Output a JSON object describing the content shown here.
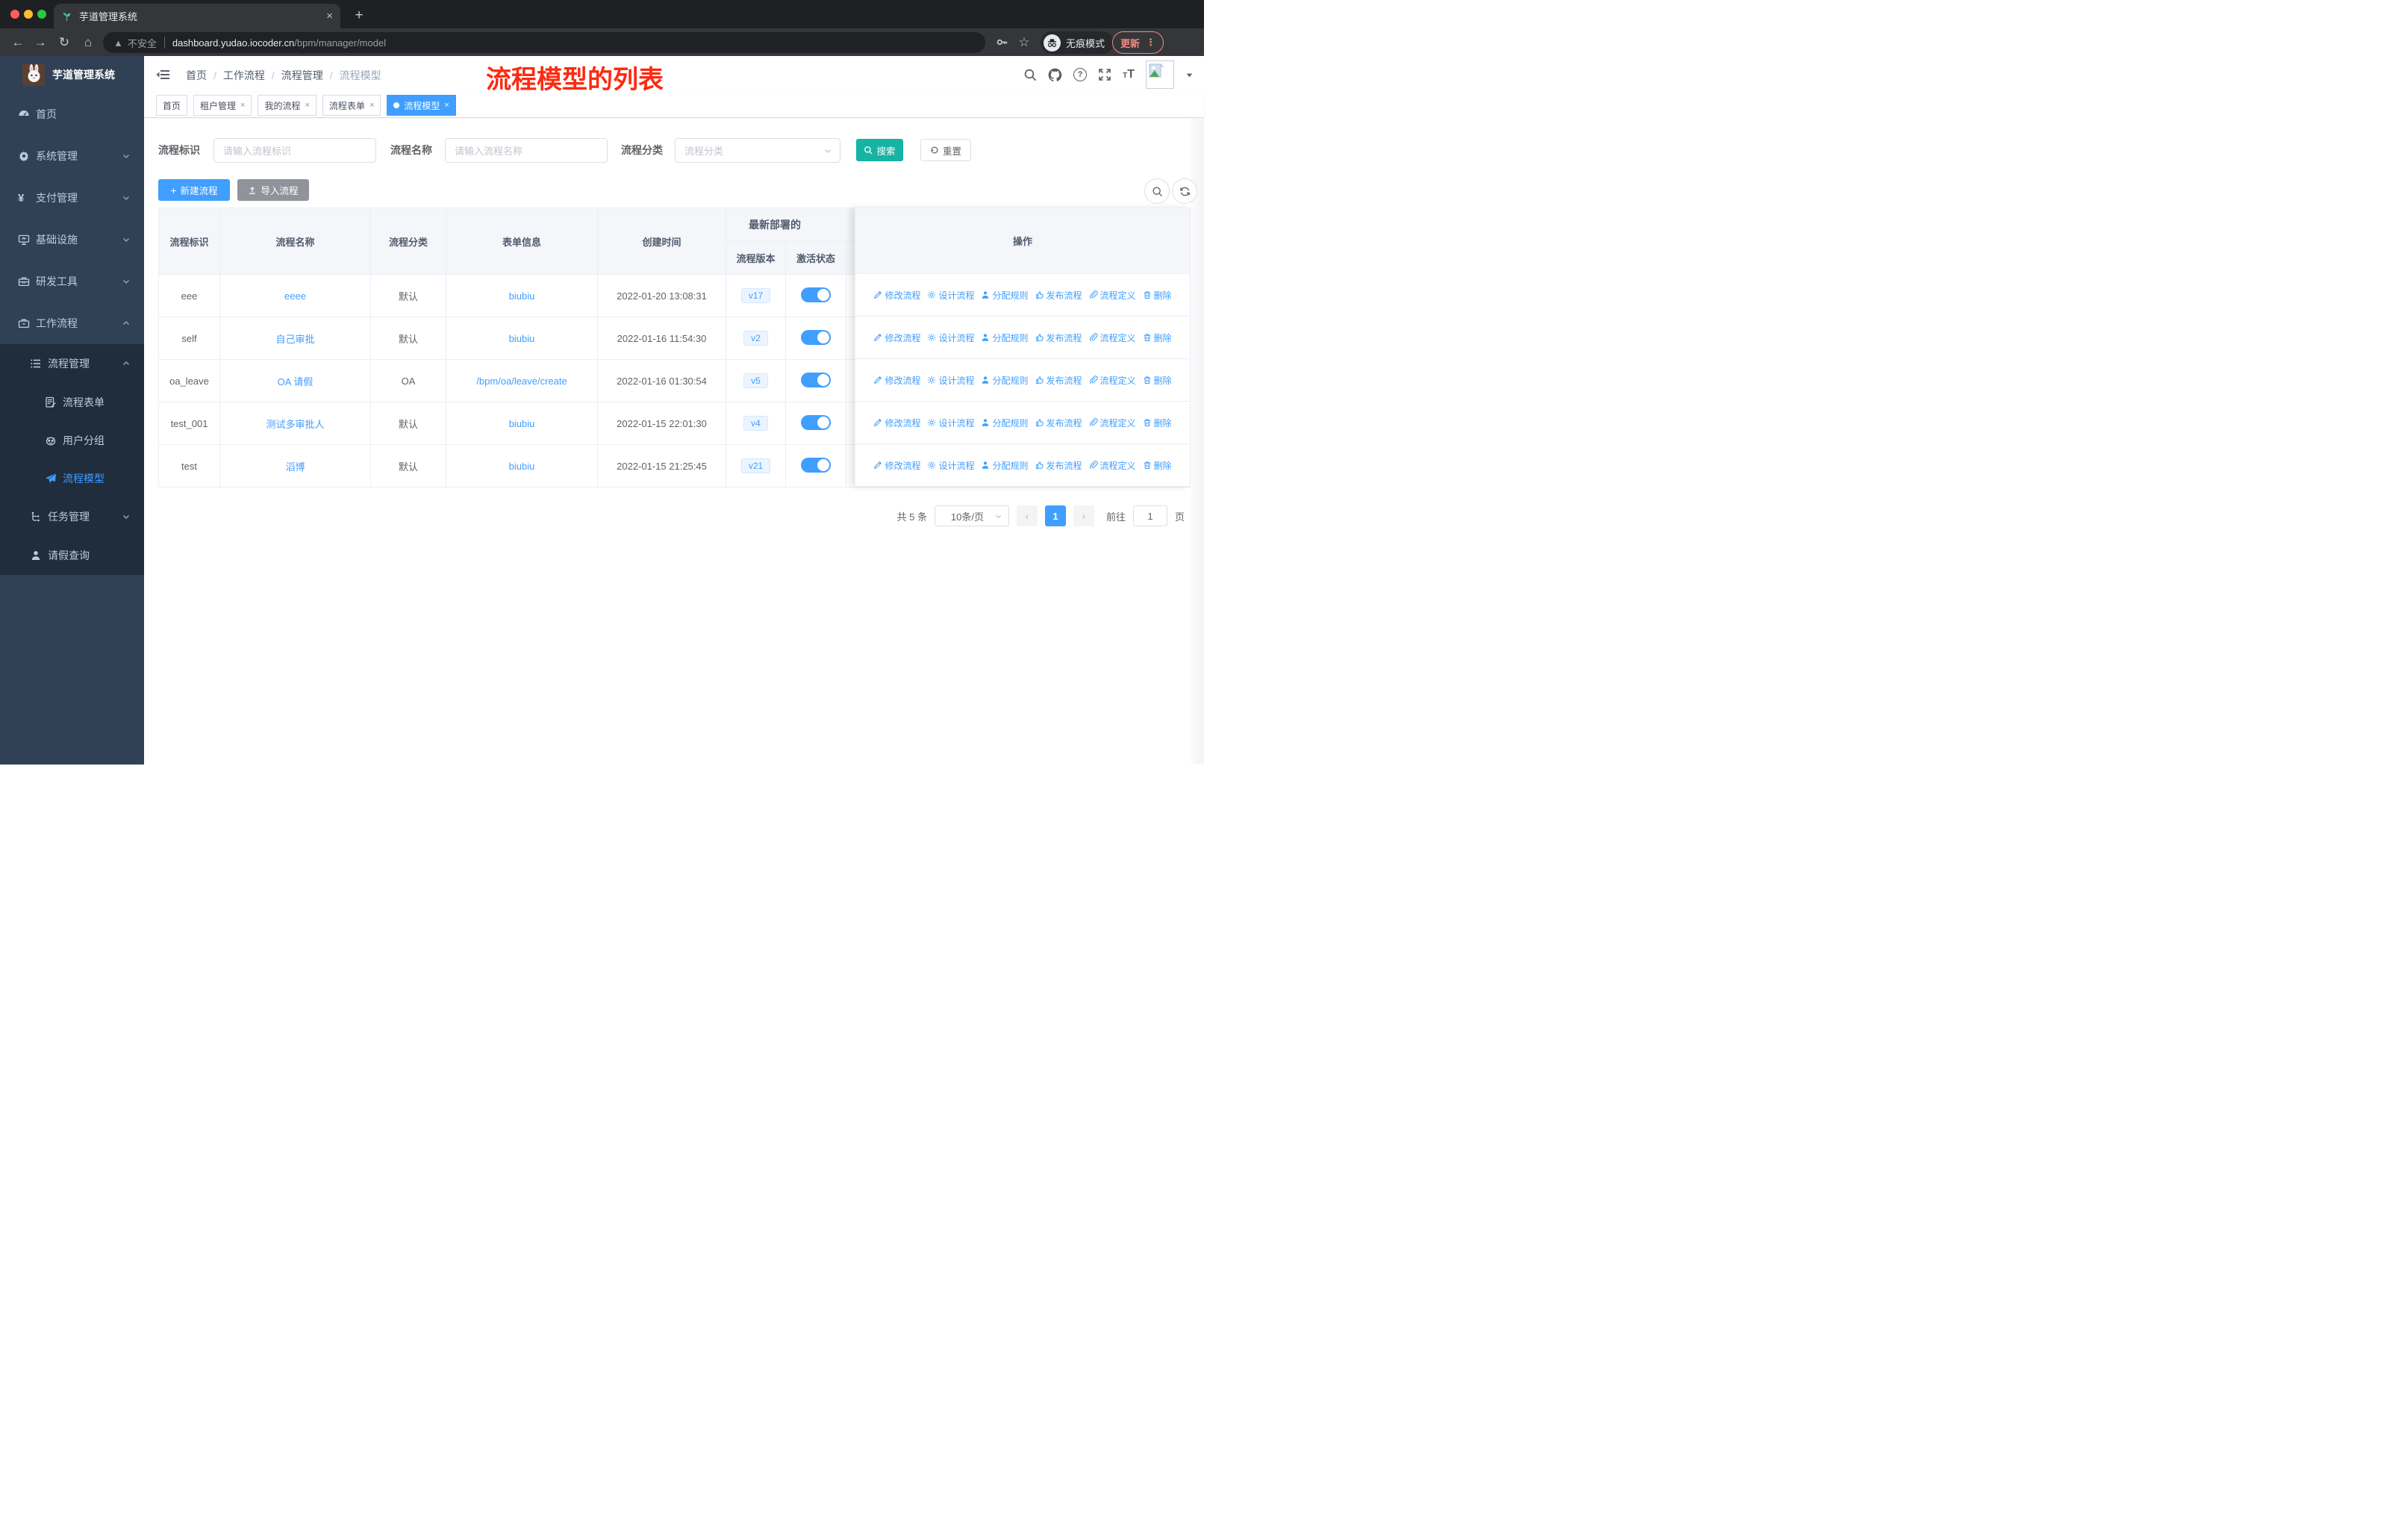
{
  "colors": {
    "accent": "#409EFF",
    "search_button": "#17B3A3",
    "annotation": "#FB2A12",
    "sidebar_bg": "#304156",
    "submenu_bg": "#1F2D3D",
    "toggle_on": "#409EFF"
  },
  "browser": {
    "tab_title": "芋道管理系统",
    "close_glyph": "×",
    "new_tab_glyph": "+",
    "security_label": "不安全",
    "url_host": "dashboard.yudao.iocoder.cn",
    "url_path": "/bpm/manager/model",
    "incognito_label": "无痕模式",
    "update_label": "更新",
    "menu_glyph": "⋮"
  },
  "sidebar": {
    "logo_title": "芋道管理系统",
    "items": [
      {
        "label": "首页"
      },
      {
        "label": "系统管理"
      },
      {
        "label": "支付管理"
      },
      {
        "label": "基础设施"
      },
      {
        "label": "研发工具"
      },
      {
        "label": "工作流程"
      }
    ],
    "submenu": [
      {
        "label": "流程管理"
      },
      {
        "label": "流程表单"
      },
      {
        "label": "用户分组"
      },
      {
        "label": "流程模型"
      },
      {
        "label": "任务管理"
      },
      {
        "label": "请假查询"
      }
    ]
  },
  "header": {
    "breadcrumb": [
      "首页",
      "工作流程",
      "流程管理",
      "流程模型"
    ],
    "annotation": "流程模型的列表"
  },
  "tags": [
    {
      "label": "首页"
    },
    {
      "label": "租户管理"
    },
    {
      "label": "我的流程"
    },
    {
      "label": "流程表单"
    },
    {
      "label": "流程模型"
    }
  ],
  "filters": {
    "key_label": "流程标识",
    "key_placeholder": "请输入流程标识",
    "name_label": "流程名称",
    "name_placeholder": "请输入流程名称",
    "category_label": "流程分类",
    "category_placeholder": "流程分类",
    "search_label": "搜索",
    "reset_label": "重置"
  },
  "toolbar": {
    "create_label": "新建流程",
    "import_label": "导入流程"
  },
  "table": {
    "headers": [
      "流程标识",
      "流程名称",
      "流程分类",
      "表单信息",
      "创建时间"
    ],
    "group_header": "最新部署的",
    "sub_headers": [
      "流程版本",
      "激活状态"
    ],
    "ops_header": "操作",
    "actions": [
      "修改流程",
      "设计流程",
      "分配规则",
      "发布流程",
      "流程定义",
      "删除"
    ],
    "rows": [
      {
        "key": "eee",
        "name": "eeee",
        "category": "默认",
        "form": "biubiu",
        "created": "2022-01-20 13:08:31",
        "version": "v17",
        "active": true
      },
      {
        "key": "self",
        "name": "自己审批",
        "category": "默认",
        "form": "biubiu",
        "created": "2022-01-16 11:54:30",
        "version": "v2",
        "active": true
      },
      {
        "key": "oa_leave",
        "name": "OA 请假",
        "category": "OA",
        "form": "/bpm/oa/leave/create",
        "created": "2022-01-16 01:30:54",
        "version": "v5",
        "active": true
      },
      {
        "key": "test_001",
        "name": "测试多审批人",
        "category": "默认",
        "form": "biubiu",
        "created": "2022-01-15 22:01:30",
        "version": "v4",
        "active": true
      },
      {
        "key": "test",
        "name": "滔博",
        "category": "默认",
        "form": "biubiu",
        "created": "2022-01-15 21:25:45",
        "version": "v21",
        "active": true
      }
    ]
  },
  "pagination": {
    "total": "共 5 条",
    "page_size": "10条/页",
    "prev": "‹",
    "page": "1",
    "next": "›",
    "goto_label": "前往",
    "goto_value": "1",
    "unit": "页"
  }
}
